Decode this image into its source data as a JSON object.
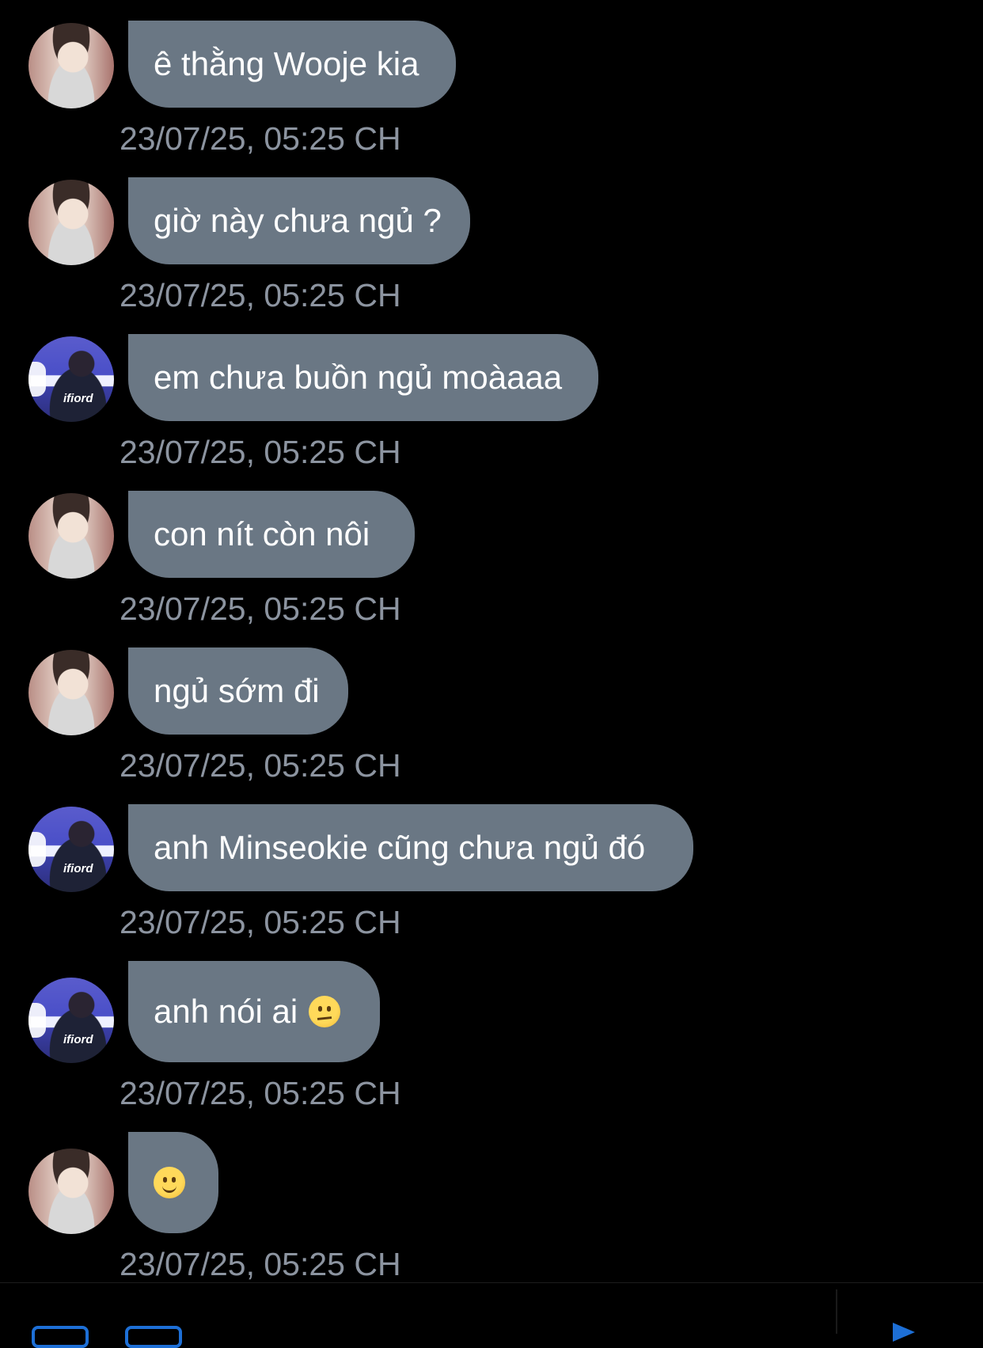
{
  "messages": [
    {
      "sender": "a1",
      "text": "ê thằng Wooje kia",
      "emoji": "",
      "time": "23/07/25, 05:25 CH"
    },
    {
      "sender": "a1",
      "text": "giờ này chưa ngủ ?",
      "emoji": "",
      "time": "23/07/25, 05:25 CH"
    },
    {
      "sender": "a2",
      "text": "em chưa buồn ngủ moàaaa",
      "emoji": "",
      "time": "23/07/25, 05:25 CH"
    },
    {
      "sender": "a1",
      "text": "con nít còn nôi",
      "emoji": "",
      "time": "23/07/25, 05:25 CH"
    },
    {
      "sender": "a1",
      "text": "ngủ sớm đi",
      "emoji": "",
      "time": "23/07/25, 05:25 CH"
    },
    {
      "sender": "a2",
      "text": "anh Minseokie cũng chưa ngủ đó",
      "emoji": "",
      "time": "23/07/25, 05:25 CH"
    },
    {
      "sender": "a2",
      "text": "anh nói ai",
      "emoji": "unamused-face",
      "time": "23/07/25, 05:25 CH"
    },
    {
      "sender": "a1",
      "text": "",
      "emoji": "slightly-smiling-face",
      "time": "23/07/25, 05:25 CH"
    }
  ],
  "colors": {
    "background": "#000000",
    "bubble": "#6a7784",
    "timestamp": "#8c94a0",
    "accent": "#1d6fd6"
  }
}
